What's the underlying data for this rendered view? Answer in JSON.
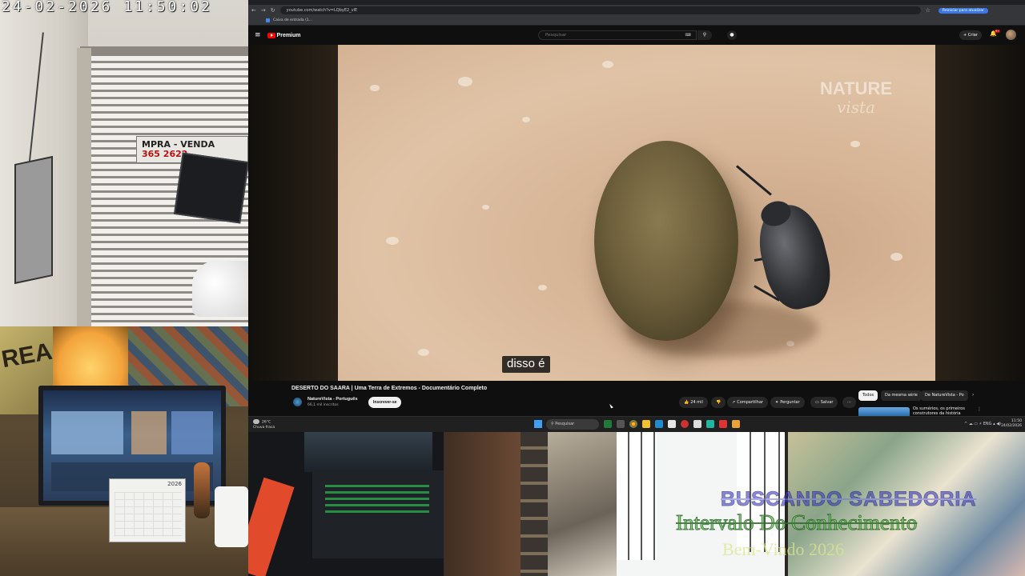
{
  "cctv": {
    "timestamp": "24-02-2026  11:50:02",
    "sign_line1": "MPRA - VENDA",
    "sign_line2": "365 2622"
  },
  "browser": {
    "url": "youtube.com/watch?v=LQbyE2_vlE",
    "update_button": "Reiniciar para atualizar",
    "bookmark": "Caixa de entrada (1..."
  },
  "youtube": {
    "logo": "Premium",
    "search_placeholder": "Pesquisar",
    "create_label": "Criar",
    "notifications_badge": "9+",
    "watermark_line1": "NATURE",
    "watermark_line2": "vista",
    "caption": "disso é",
    "video_title": "DESERTO DO SAARA | Uma Terra de Extremos - Documentário Completo",
    "channel_name": "NatureVista - Português",
    "channel_subs": "66,1 mil inscritos",
    "subscribe_label": "Inscrever-se",
    "likes": "24 mil",
    "share_label": "Compartilhar",
    "ask_label": "Perguntar",
    "save_label": "Salvar",
    "chips": [
      "Todos",
      "Da mesma série",
      "De NatureVista - Po"
    ],
    "rec_title": "Os sumérios, os primeiros construtores da história"
  },
  "taskbar": {
    "weather_temp": "26°C",
    "weather_desc": "Chuva fraca",
    "search_placeholder": "Pesquisar",
    "lang": "ENG",
    "time": "11:50",
    "date": "24/02/2026"
  },
  "cam1": {
    "graffiti": "REA",
    "calendar_year": "2026"
  },
  "overlay": {
    "brand": "BUSCANDO SABEDORIA",
    "title": "Intervalo Do Conhecimento",
    "subtitle": "Bem-Vindo 2026"
  }
}
